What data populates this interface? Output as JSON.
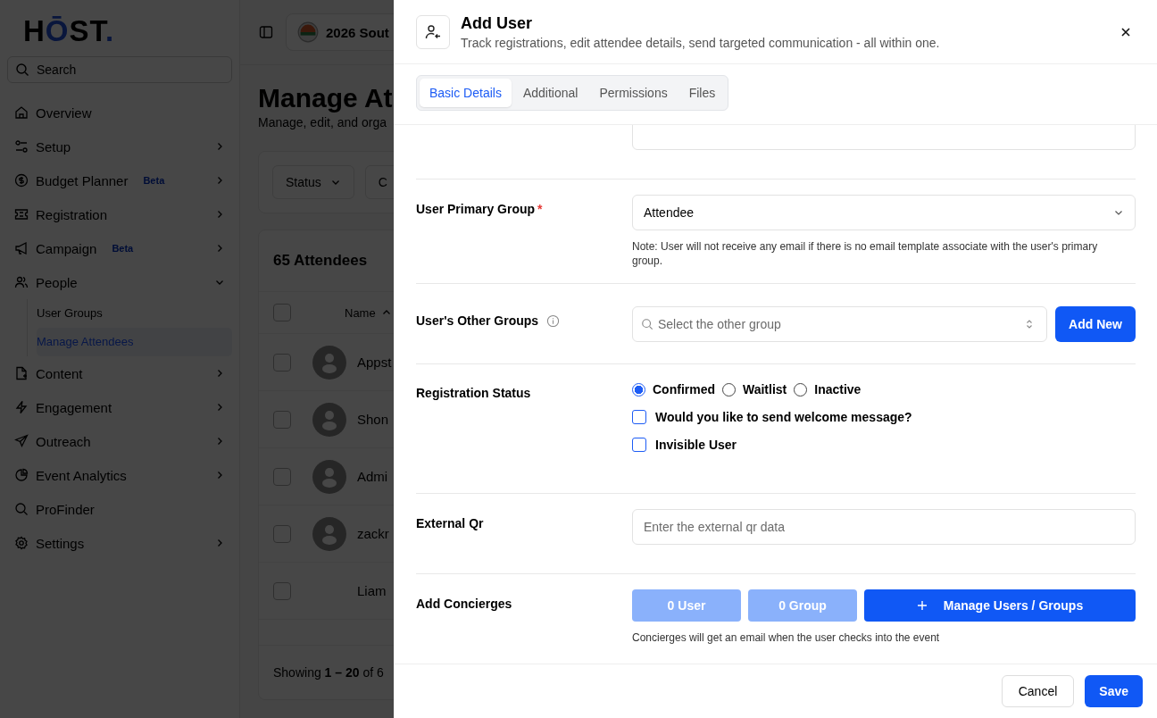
{
  "logo": {
    "parts": [
      {
        "text": "H",
        "accent": false
      },
      {
        "text": "Ō",
        "accent": true
      },
      {
        "text": "ST",
        "accent": false
      },
      {
        "text": ".",
        "accent": true
      }
    ]
  },
  "sidebar": {
    "search": {
      "placeholder": "Search"
    },
    "items": [
      {
        "label": "Overview",
        "kind": "link"
      },
      {
        "label": "Setup",
        "kind": "group",
        "expanded": false
      },
      {
        "label": "Budget Planner",
        "kind": "group",
        "expanded": false,
        "badge": "Beta"
      },
      {
        "label": "Registration",
        "kind": "group",
        "expanded": false
      },
      {
        "label": "Campaign",
        "kind": "group",
        "expanded": false,
        "badge": "Beta"
      },
      {
        "label": "People",
        "kind": "group",
        "expanded": true,
        "children": [
          {
            "label": "User Groups",
            "selected": false
          },
          {
            "label": "Manage Attendees",
            "selected": true
          }
        ]
      },
      {
        "label": "Content",
        "kind": "group",
        "expanded": false
      },
      {
        "label": "Engagement",
        "kind": "group",
        "expanded": false
      },
      {
        "label": "Outreach",
        "kind": "group",
        "expanded": false
      },
      {
        "label": "Event Analytics",
        "kind": "group",
        "expanded": false
      },
      {
        "label": "ProFinder",
        "kind": "link"
      },
      {
        "label": "Settings",
        "kind": "group",
        "expanded": false
      }
    ]
  },
  "main": {
    "event": "2026 Sout",
    "title": "Manage At",
    "subtitle": "Manage, edit, and orga",
    "filters": [
      "Status",
      "C"
    ],
    "table": {
      "title": "65 Attendees",
      "column": "Name",
      "header_checked": false,
      "rows": [
        {
          "name": "Appst",
          "avatar": true,
          "checked": false
        },
        {
          "name": "Shon",
          "avatar": true,
          "checked": false
        },
        {
          "name": "Admi",
          "avatar": true,
          "checked": false
        },
        {
          "name": "zackr",
          "avatar": true,
          "checked": false
        },
        {
          "name": "Liam",
          "avatar": false,
          "checked": false
        }
      ],
      "footer": "Showing **1 – 20** of 6"
    }
  },
  "drawer": {
    "title": "Add User",
    "subtitle": "Track registrations, edit attendee details, send targeted communication - all within one.",
    "tabs": [
      {
        "label": "Basic Details",
        "selected": true
      },
      {
        "label": "Additional",
        "selected": false
      },
      {
        "label": "Permissions",
        "selected": false
      },
      {
        "label": "Files",
        "selected": false
      }
    ],
    "fields": [
      {
        "kind": "input"
      },
      {
        "kind": "select",
        "label": "User Primary Group",
        "required_mark": "*",
        "value": "Attendee",
        "note": "Note: User will not receive any email if there is no email template associate with the user's primary group."
      },
      {
        "kind": "combo",
        "label": "User's Other Groups",
        "info": true,
        "placeholder": "Select the other group",
        "button": "Add New"
      },
      {
        "kind": "status",
        "label": "Registration Status",
        "options": [
          {
            "label": "Confirmed",
            "selected": true
          },
          {
            "label": "Waitlist",
            "selected": false
          },
          {
            "label": "Inactive",
            "selected": false
          }
        ],
        "checks": [
          {
            "label": "Would you like to send welcome message?",
            "checked": false
          },
          {
            "label": "Invisible User",
            "checked": false
          }
        ]
      },
      {
        "kind": "input",
        "label": "External Qr",
        "placeholder": "Enter the external qr data"
      },
      {
        "kind": "concierges",
        "label": "Add Concierges",
        "buttons": [
          {
            "label": "0 User",
            "kind": "light"
          },
          {
            "label": "0 Group",
            "kind": "light"
          },
          {
            "label": "Manage Users / Groups",
            "kind": "primary"
          }
        ],
        "note": "Concierges will get an email when the user checks into the event"
      }
    ],
    "cancel": "Cancel",
    "save": "Save"
  }
}
